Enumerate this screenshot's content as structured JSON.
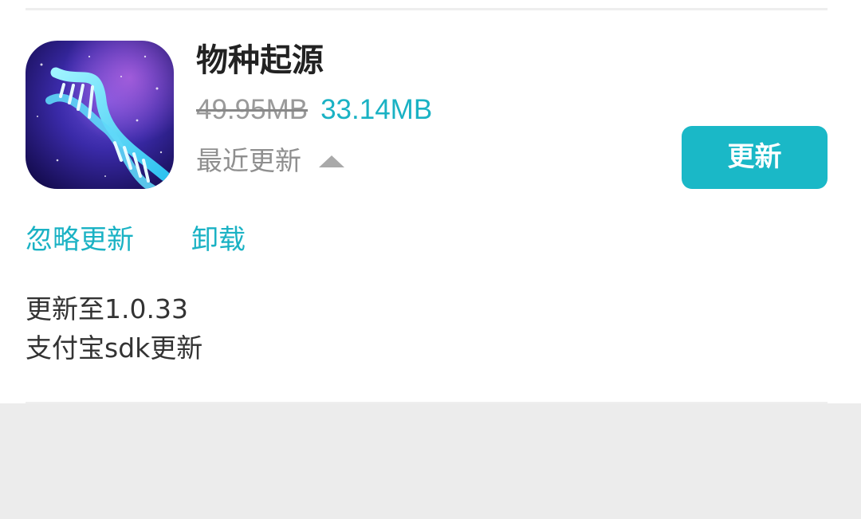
{
  "app": {
    "name": "物种起源",
    "icon": "dna-helix-app-icon",
    "old_size": "49.95MB",
    "new_size": "33.14MB",
    "recent_label": "最近更新",
    "recent_toggle_icon": "caret-up-icon"
  },
  "actions": {
    "update_label": "更新",
    "ignore_label": "忽略更新",
    "uninstall_label": "卸载"
  },
  "release_notes": [
    "更新至1.0.33",
    "支付宝sdk更新"
  ],
  "colors": {
    "accent": "#1ab8c7",
    "link": "#1ab2c4",
    "page_background": "#ececec",
    "card_background": "#ffffff"
  }
}
